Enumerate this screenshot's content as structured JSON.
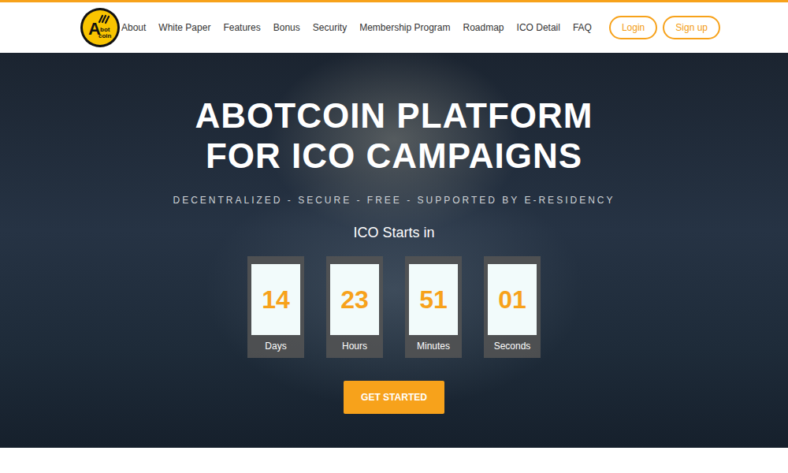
{
  "header": {
    "logo": {
      "letter": "A",
      "lines": [
        "bot",
        "coin"
      ]
    },
    "nav": [
      "About",
      "White Paper",
      "Features",
      "Bonus",
      "Security",
      "Membership Program",
      "Roadmap",
      "ICO Detail",
      "FAQ"
    ],
    "auth": [
      "Login",
      "Sign up"
    ]
  },
  "hero": {
    "title_lines": [
      "ABOTCOIN PLATFORM",
      "FOR ICO CAMPAIGNS"
    ],
    "tagline": "DECENTRALIZED - SECURE - FREE - SUPPORTED BY E-RESIDENCY",
    "countdown_title": "ICO Starts in",
    "countdown": [
      {
        "value": "14",
        "label": "Days"
      },
      {
        "value": "23",
        "label": "Hours"
      },
      {
        "value": "51",
        "label": "Minutes"
      },
      {
        "value": "01",
        "label": "Seconds"
      }
    ],
    "cta": "GET STARTED"
  }
}
